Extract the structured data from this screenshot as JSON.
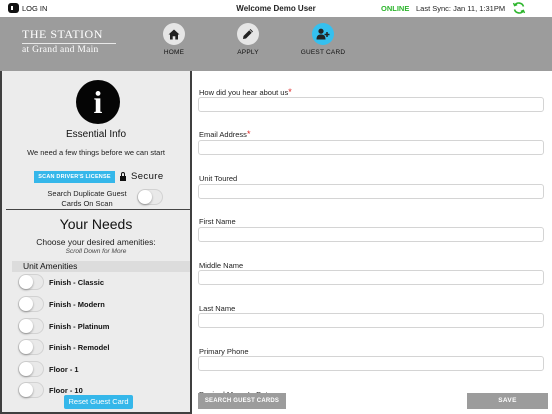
{
  "status_bar": {
    "login_label": "LOG IN",
    "welcome": "Welcome Demo User",
    "online": "ONLINE",
    "last_sync": "Last Sync: Jan 11, 1:31PM"
  },
  "header": {
    "logo_line1": "THE STATION",
    "logo_line2": "at Grand and Main",
    "nav": [
      {
        "label": "HOME",
        "icon": "home-icon"
      },
      {
        "label": "APPLY",
        "icon": "pencil-icon"
      },
      {
        "label": "GUEST CARD",
        "icon": "add-user-icon",
        "active": true
      }
    ]
  },
  "left_panel": {
    "info_glyph": "i",
    "essential_title": "Essential Info",
    "need_text": "We need a few things before we can start",
    "scan_button": "SCAN DRIVER'S LICENSE",
    "secure_label": "Secure",
    "dup_text": "Search Duplicate Guest Cards On Scan",
    "your_needs": "Your Needs",
    "choose": "Choose your desired amenities:",
    "scroll_hint": "Scroll Down for More",
    "unit_amenities": "Unit Amenities",
    "amenities": [
      "Finish - Classic",
      "Finish - Modern",
      "Finish - Platinum",
      "Finish - Remodel",
      "Floor - 1",
      "Floor - 10"
    ],
    "reset_button": "Reset Guest Card"
  },
  "form": {
    "fields": [
      {
        "label": "How did you hear about us",
        "required": true
      },
      {
        "label": "Email Address",
        "required": true
      },
      {
        "label": "Unit Toured",
        "required": false
      },
      {
        "label": "First Name",
        "required": false
      },
      {
        "label": "Middle Name",
        "required": false
      },
      {
        "label": "Last Name",
        "required": false
      },
      {
        "label": "Primary Phone",
        "required": false
      },
      {
        "label": "Desired Move-In Date",
        "required": false
      }
    ],
    "required_mark": "*",
    "search_button": "SEARCH GUEST CARDS",
    "save_button": "SAVE"
  },
  "colors": {
    "accent": "#35b7ea",
    "online": "#2db52d",
    "header_bg": "#9c9c9c",
    "required": "#dd2222"
  }
}
